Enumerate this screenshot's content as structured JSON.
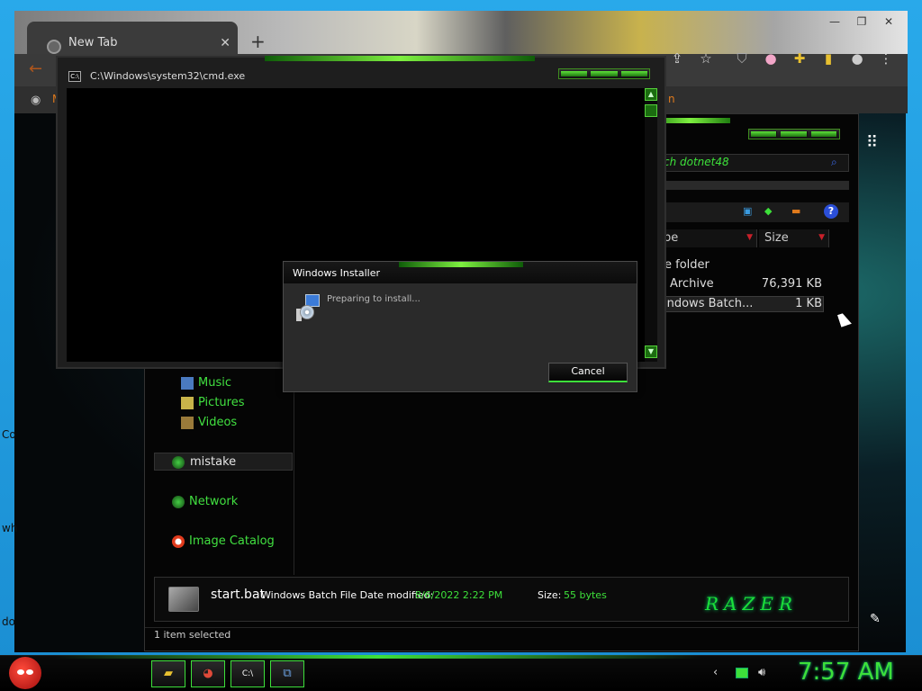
{
  "desktop": {
    "labels": [
      "Co",
      "wh",
      "do"
    ]
  },
  "chrome": {
    "tab_title": "New Tab",
    "tab_close": "✕",
    "new_tab": "+",
    "bookmark_left": "M",
    "bookmark_right": "n"
  },
  "cmd": {
    "title": "C:\\Windows\\system32\\cmd.exe",
    "icon_text": "C:\\",
    "scroll_up": "▲",
    "scroll_down": "▼"
  },
  "explorer": {
    "address": "ch dotnet48",
    "columns": [
      {
        "label": "pe"
      },
      {
        "label": "Size"
      }
    ],
    "files": [
      {
        "type": "e folder",
        "size": ""
      },
      {
        "type": "Archive",
        "size": "76,391 KB"
      },
      {
        "type": "indows Batch...",
        "size": "1 KB"
      }
    ],
    "nav": [
      {
        "label": "Music"
      },
      {
        "label": "Pictures"
      },
      {
        "label": "Videos"
      },
      {
        "label": "mistake"
      },
      {
        "label": "Network"
      },
      {
        "label": "Image Catalog"
      }
    ],
    "details": {
      "name": "start.bat",
      "type": "Windows Batch File",
      "date_label": "Date modified:",
      "date_value": "8/6/2022 2:22 PM",
      "size_label": "Size:",
      "size_value": "55 bytes"
    },
    "brand": "RAZER",
    "status": "1 item selected",
    "help": "?"
  },
  "installer": {
    "title": "Windows Installer",
    "message": "Preparing to install...",
    "cancel_label": "Cancel"
  },
  "taskbar": {
    "clock": "7:57 AM"
  }
}
